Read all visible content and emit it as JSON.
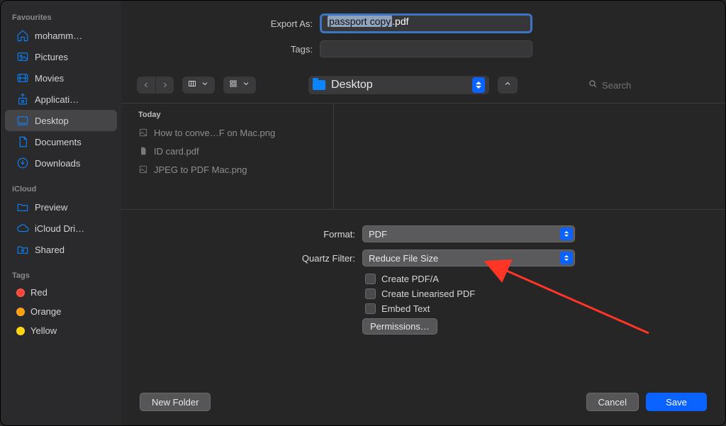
{
  "sidebar": {
    "sections": [
      {
        "title": "Favourites",
        "items": [
          {
            "icon": "home",
            "label": "mohamm…"
          },
          {
            "icon": "pictures",
            "label": "Pictures"
          },
          {
            "icon": "movies",
            "label": "Movies"
          },
          {
            "icon": "apps",
            "label": "Applicati…"
          },
          {
            "icon": "desktop",
            "label": "Desktop",
            "selected": true
          },
          {
            "icon": "documents",
            "label": "Documents"
          },
          {
            "icon": "downloads",
            "label": "Downloads"
          }
        ]
      },
      {
        "title": "iCloud",
        "items": [
          {
            "icon": "folder",
            "label": "Preview"
          },
          {
            "icon": "cloud",
            "label": "iCloud Dri…"
          },
          {
            "icon": "shared",
            "label": "Shared"
          }
        ]
      },
      {
        "title": "Tags",
        "items": [
          {
            "icon": "tag",
            "color": "#ff453a",
            "label": "Red"
          },
          {
            "icon": "tag",
            "color": "#ff9f0a",
            "label": "Orange"
          },
          {
            "icon": "tag",
            "color": "#ffd60a",
            "label": "Yellow"
          }
        ]
      }
    ]
  },
  "header": {
    "export_as_label": "Export As:",
    "filename_base": "passport copy",
    "filename_ext": ".pdf",
    "tags_label": "Tags:"
  },
  "toolbar": {
    "location": "Desktop",
    "search_placeholder": "Search"
  },
  "browser": {
    "group_header": "Today",
    "files": [
      {
        "kind": "png",
        "name": "How to conve…F on Mac.png"
      },
      {
        "kind": "pdf",
        "name": "ID card.pdf"
      },
      {
        "kind": "png",
        "name": "JPEG to PDF Mac.png"
      }
    ]
  },
  "options": {
    "format_label": "Format:",
    "format_value": "PDF",
    "quartz_label": "Quartz Filter:",
    "quartz_value": "Reduce File Size",
    "create_pdfa_label": "Create PDF/A",
    "create_linearised_label": "Create Linearised PDF",
    "embed_text_label": "Embed Text",
    "permissions_label": "Permissions…"
  },
  "footer": {
    "new_folder": "New Folder",
    "cancel": "Cancel",
    "save": "Save"
  },
  "colors": {
    "accent": "#0a84ff"
  }
}
